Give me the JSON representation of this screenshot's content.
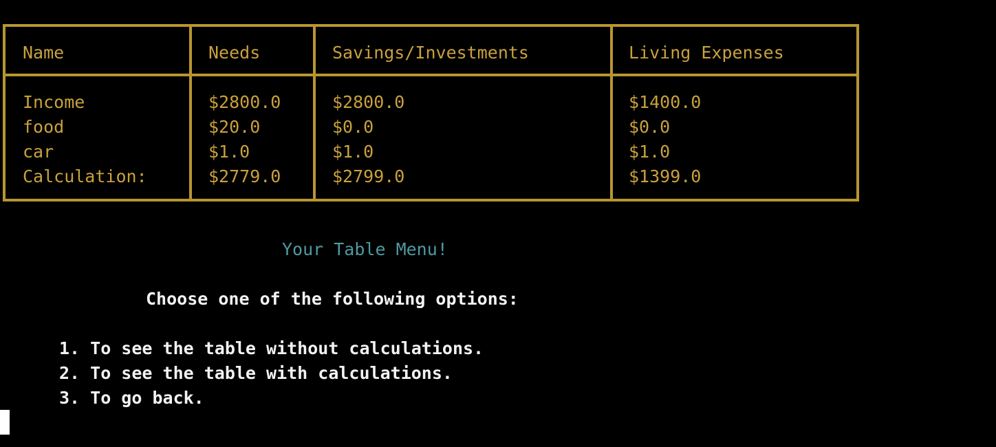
{
  "table": {
    "headers": [
      "Name",
      "Needs",
      "Savings/Investments",
      "Living Expenses"
    ],
    "rows": [
      [
        "Income",
        "$2800.0",
        "$2800.0",
        "$1400.0"
      ],
      [
        "food",
        "$20.0",
        "$0.0",
        "$0.0"
      ],
      [
        "car",
        "$1.0",
        "$1.0",
        "$1.0"
      ],
      [
        "Calculation:",
        "$2779.0",
        "$2799.0",
        "$1399.0"
      ]
    ]
  },
  "menu": {
    "title": "Your Table Menu!",
    "prompt": "Choose one of the following options:",
    "options": [
      "1. To see the table without calculations.",
      "2. To see the table with calculations.",
      "3. To go back."
    ]
  },
  "colors": {
    "background": "#000000",
    "table": "#c9a13c",
    "title": "#4f9aa0",
    "text": "#f2f2f2"
  }
}
